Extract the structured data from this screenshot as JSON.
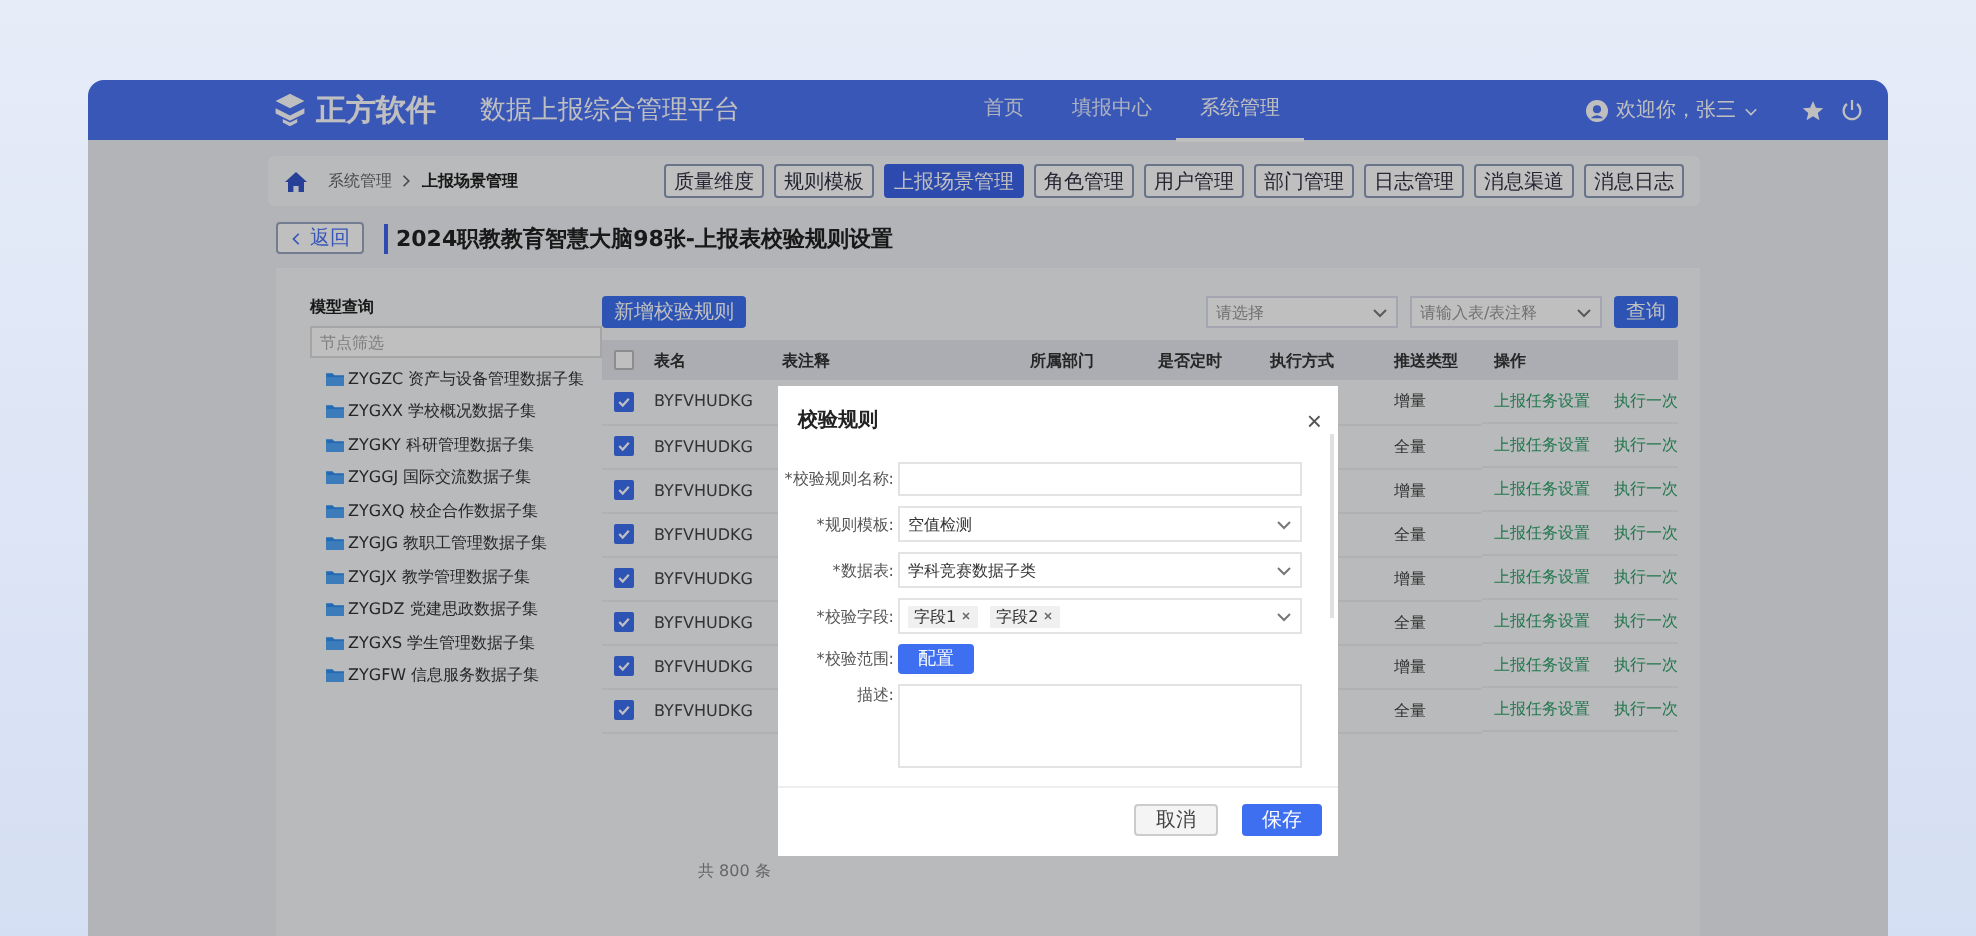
{
  "header": {
    "logo": "正方软件",
    "title": "数据上报综合管理平台",
    "nav": [
      {
        "label": "首页",
        "selected": false
      },
      {
        "label": "填报中心",
        "selected": false
      },
      {
        "label": "系统管理",
        "selected": true
      }
    ],
    "user": "欢迎你，张三"
  },
  "breadcrumb": [
    "系统管理",
    "上报场景管理"
  ],
  "tabs": [
    {
      "label": "质量维度",
      "selected": false
    },
    {
      "label": "规则模板",
      "selected": false
    },
    {
      "label": "上报场景管理",
      "selected": true
    },
    {
      "label": "角色管理",
      "selected": false
    },
    {
      "label": "用户管理",
      "selected": false
    },
    {
      "label": "部门管理",
      "selected": false
    },
    {
      "label": "日志管理",
      "selected": false
    },
    {
      "label": "消息渠道",
      "selected": false
    },
    {
      "label": "消息日志",
      "selected": false
    }
  ],
  "back_button": "返回",
  "page_title": "2024职教教育智慧大脑98张-上报表校验规则设置",
  "sidebar": {
    "title": "模型查询",
    "filter_placeholder": "节点筛选",
    "items": [
      "ZYGZC 资产与设备管理数据子集",
      "ZYGXX 学校概况数据子集",
      "ZYGKY 科研管理数据子集",
      "ZYGGJ 国际交流数据子集",
      "ZYGXQ 校企合作数据子集",
      "ZYGJG 教职工管理数据子集",
      "ZYGJX 教学管理数据子集",
      "ZYGDZ 党建思政数据子集",
      "ZYGXS 学生管理数据子集",
      "ZYGFW 信息服务数据子集"
    ]
  },
  "toolbar": {
    "add_button": "新增校验规则",
    "select_placeholder": "请选择",
    "search_placeholder": "请输入表/表注释",
    "query_button": "查询"
  },
  "table": {
    "header_checked": false,
    "columns": [
      "表名",
      "表注释",
      "所属部门",
      "是否定时",
      "执行方式",
      "推送类型",
      "操作"
    ],
    "rows": [
      {
        "checked": true,
        "name": "BYFVHUDKG",
        "push": "增量",
        "actions": [
          "上报任务设置",
          "执行一次"
        ]
      },
      {
        "checked": true,
        "name": "BYFVHUDKG",
        "push": "全量",
        "actions": [
          "上报任务设置",
          "执行一次"
        ]
      },
      {
        "checked": true,
        "name": "BYFVHUDKG",
        "push": "增量",
        "actions": [
          "上报任务设置",
          "执行一次"
        ]
      },
      {
        "checked": true,
        "name": "BYFVHUDKG",
        "push": "全量",
        "actions": [
          "上报任务设置",
          "执行一次"
        ]
      },
      {
        "checked": true,
        "name": "BYFVHUDKG",
        "push": "增量",
        "actions": [
          "上报任务设置",
          "执行一次"
        ]
      },
      {
        "checked": true,
        "name": "BYFVHUDKG",
        "push": "全量",
        "actions": [
          "上报任务设置",
          "执行一次"
        ]
      },
      {
        "checked": true,
        "name": "BYFVHUDKG",
        "push": "增量",
        "actions": [
          "上报任务设置",
          "执行一次"
        ]
      },
      {
        "checked": true,
        "name": "BYFVHUDKG",
        "push": "全量",
        "actions": [
          "上报任务设置",
          "执行一次"
        ]
      }
    ],
    "total": "共 800 条"
  },
  "dialog": {
    "title": "校验规则",
    "close": "×",
    "fields": [
      {
        "kind": "input",
        "label": "*校验规则名称:"
      },
      {
        "kind": "select",
        "label": "*规则模板:",
        "value": "空值检测"
      },
      {
        "kind": "select",
        "label": "*数据表:",
        "value": "学科竞赛数据子类"
      },
      {
        "kind": "tags",
        "label": "*校验字段:",
        "tags": [
          "字段1",
          "字段2"
        ]
      },
      {
        "kind": "button",
        "label": "*校验范围:",
        "button": "配置"
      },
      {
        "kind": "textarea",
        "label": "描述:"
      }
    ],
    "buttons": [
      {
        "label": "取消",
        "kind": "secondary"
      },
      {
        "label": "保存",
        "kind": "primary"
      }
    ]
  }
}
